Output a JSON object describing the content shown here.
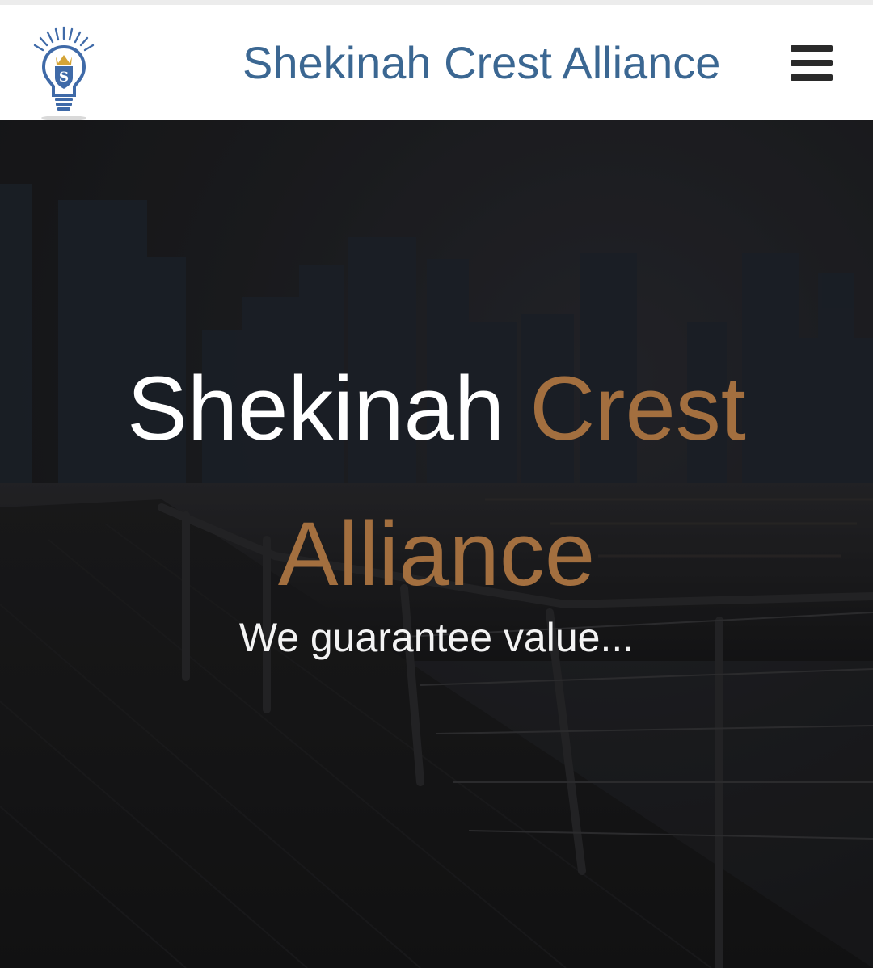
{
  "header": {
    "site_title": "Shekinah Crest Alliance",
    "logo_icon": "lightbulb-crest-logo-icon",
    "menu_icon": "hamburger-menu-icon"
  },
  "hero": {
    "title_part1": "Shekinah",
    "title_part2": "Crest",
    "title_part3": "Alliance",
    "tagline": "We guarantee value...",
    "background": "night-city-skyline-waterfront-photo"
  },
  "colors": {
    "brand_blue": "#3b6792",
    "accent_bronze": "#a36f3f",
    "header_bg": "#ffffff",
    "hero_text": "#ffffff"
  }
}
